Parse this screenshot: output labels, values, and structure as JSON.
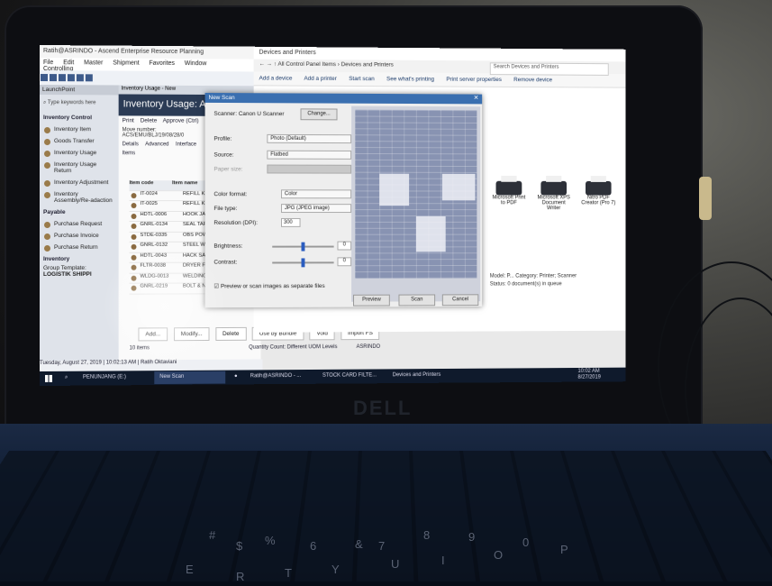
{
  "erp": {
    "title": "Ratih@ASRINDO - Ascend Enterprise Resource Planning",
    "menu": [
      "File",
      "Edit",
      "Master",
      "Shipment",
      "Favorites",
      "Window",
      "Controlling"
    ],
    "launchpoint": "LaunchPoint",
    "search_placeholder": "Type keywords here",
    "sections": [
      {
        "title": "Inventory Control",
        "items": [
          "Inventory Item",
          "Goods Transfer",
          "Inventory Usage",
          "Inventory Usage Return",
          "Inventory Adjustment",
          "Inventory Assembly/Re-adaction"
        ]
      },
      {
        "title": "Payable",
        "items": [
          "Purchase Request",
          "Purchase Invoice",
          "Purchase Return"
        ]
      }
    ],
    "group_label": "Inventory",
    "group_template_label": "Group Template:",
    "group_template_value": "LOGISTIK SHIPPI",
    "date_status": "Tuesday, August 27, 2019",
    "time_status": "10:02:13 AM",
    "user_status": "Ratih Oktaviani",
    "tab_label": "Inventory Usage - New",
    "header": "Inventory Usage: ACS",
    "actions": [
      "Print",
      "Delete",
      "Approve (Ctrl)"
    ],
    "move_number_label": "Move number:",
    "move_number_value": "ACS/EMU/BLJ/19/08/28/0",
    "doc_tabs": [
      "Details",
      "Advanced",
      "Interface"
    ],
    "grid_caption": "Items",
    "grid_headers": [
      "Item code",
      "Item name"
    ],
    "grid_rows": [
      [
        "IT-0024",
        "REFILL KIT IN"
      ],
      [
        "IT-0025",
        "REFILL KIT C"
      ],
      [
        "HDTL-0006",
        "HOOK JAW"
      ],
      [
        "GNRL-0134",
        "SEAL TAPE"
      ],
      [
        "STDE-0335",
        "OBS POWER"
      ],
      [
        "GNRL-0132",
        "STEEL WIRE"
      ],
      [
        "HDTL-0043",
        "HACK SAW B"
      ],
      [
        "FLTR-0038",
        "DRYER FILTE"
      ],
      [
        "WLDG-0013",
        "WELDING RO"
      ],
      [
        "GNRL-0219",
        "BOLT & NUT"
      ]
    ],
    "buttons": [
      "Add...",
      "Modify...",
      "Delete",
      "Use by Bundle",
      "Void",
      "Import FS"
    ],
    "item_count": "10 items",
    "quantity_count": "Quantity Count: Different UOM Levels",
    "company": "ASRINDO"
  },
  "explorer": {
    "title": "Devices and Printers",
    "address": "All Control Panel Items  ›  Devices and Printers",
    "search_placeholder": "Search Devices and Printers",
    "commands": [
      "Add a device",
      "Add a printer",
      "Start scan",
      "See what's printing",
      "Print server properties",
      "Remove device"
    ],
    "printers": [
      "Microsoft Print to PDF",
      "Microsoft XPS Document Writer",
      "Nitro PDF Creator (Pro 7)"
    ],
    "detail_model": "Model: P... Category: Printer; Scanner",
    "detail_status": "Status: 0 document(s) in queue"
  },
  "scan_dialog": {
    "title": "New Scan",
    "scanner": "Scanner: Canon U Scanner",
    "change_button": "Change...",
    "profile_label": "Profile:",
    "profile_value": "Photo (Default)",
    "source_label": "Source:",
    "source_value": "Flatbed",
    "paper_size_label": "Paper size:",
    "color_format_label": "Color format:",
    "color_format_value": "Color",
    "file_type_label": "File type:",
    "file_type_value": "JPG (JPEG image)",
    "resolution_label": "Resolution (DPI):",
    "resolution_value": "300",
    "brightness_label": "Brightness:",
    "brightness_value": "0",
    "contrast_label": "Contrast:",
    "contrast_value": "0",
    "separate_files_label": "Preview or scan images as separate files",
    "preview_button": "Preview",
    "scan_button": "Scan",
    "cancel_button": "Cancel"
  },
  "taskbar": {
    "items": [
      "PENUNJANG (E:)",
      "New Scan",
      "Ratih@ASRINDO - ...",
      "STOCK CARD FILTE...",
      "Devices and Printers"
    ],
    "time": "10:02 AM",
    "date": "8/27/2019"
  },
  "laptop_brand": "DELL",
  "keys": [
    "#",
    "$",
    "%",
    "6",
    "&",
    "7",
    "8",
    "9",
    "0",
    "E",
    "R",
    "T",
    "Y",
    "U",
    "I",
    "O",
    "P"
  ]
}
